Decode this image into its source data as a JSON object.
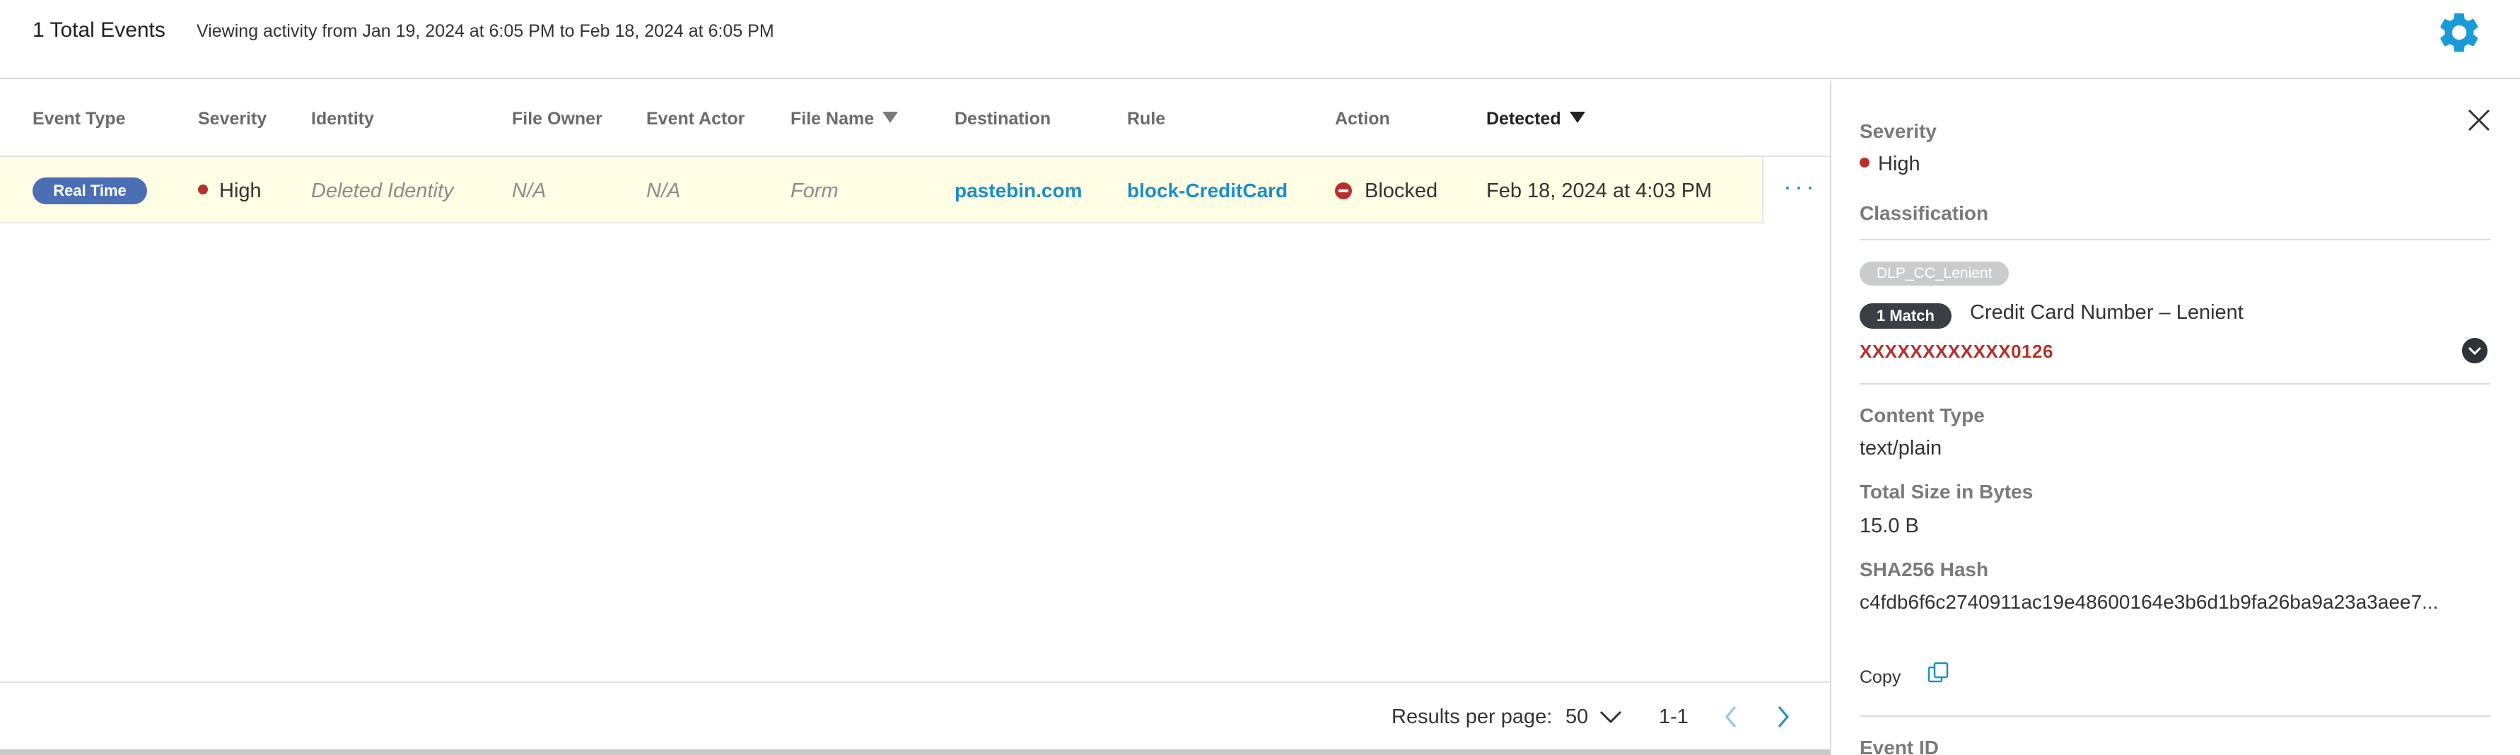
{
  "header": {
    "total_events": "1 Total Events",
    "viewing_range": "Viewing activity from Jan 19, 2024 at 6:05 PM to Feb 18, 2024 at 6:05 PM",
    "settings_icon": "gear-icon",
    "accent_color": "#1a9bd7"
  },
  "table": {
    "columns": [
      "Event Type",
      "Severity",
      "Identity",
      "File Owner",
      "Event Actor",
      "File Name",
      "Destination",
      "Rule",
      "Action",
      "Detected"
    ],
    "sorted_column": "Detected",
    "rows": [
      {
        "event_type": "Real Time",
        "severity": "High",
        "identity": "Deleted Identity",
        "file_owner": "N/A",
        "event_actor": "N/A",
        "file_name": "Form",
        "destination": "pastebin.com",
        "rule": "block-CreditCard",
        "action": "Blocked",
        "detected": "Feb 18, 2024 at 4:03 PM",
        "more": "···"
      }
    ]
  },
  "pagination": {
    "results_per_page_label": "Results per page:",
    "results_per_page": "50",
    "range": "1-1"
  },
  "details": {
    "severity_label": "Severity",
    "severity": "High",
    "classification_label": "Classification",
    "classification_tag": "DLP_CC_Lenient",
    "match_badge": "1 Match",
    "match_name": "Credit Card Number – Lenient",
    "masked_value": "XXXXXXXXXXXX0126",
    "content_type_label": "Content Type",
    "content_type": "text/plain",
    "size_label": "Total Size in Bytes",
    "size": "15.0 B",
    "hash_label": "SHA256 Hash",
    "hash": "c4fdb6f6c2740911ac19e48600164e3b6d1b9fa26ba9a23a3aee7...",
    "copy_label": "Copy",
    "event_id_label": "Event ID"
  },
  "colors": {
    "severity_high": "#b7312c",
    "link": "#1a8fc9",
    "row_highlight": "#fffde3",
    "badge_realtime": "#4a6fb5"
  }
}
